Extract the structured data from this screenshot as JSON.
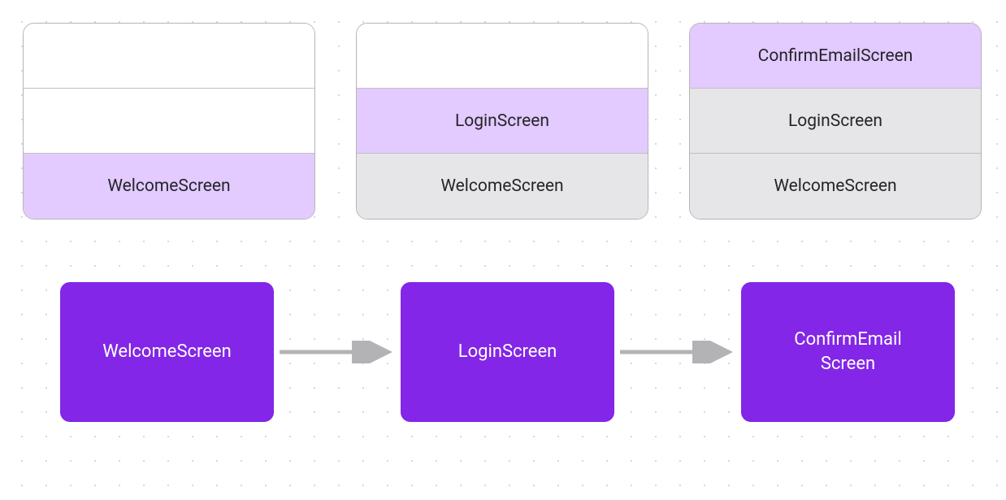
{
  "colors": {
    "accent_purple": "#8326e7",
    "lilac_highlight": "#e3caff",
    "grey_inactive": "#e6e6e8",
    "arrow": "#b3b3b6",
    "text_dark": "#25252b",
    "text_light": "#ffffff"
  },
  "stacks": [
    {
      "cells": [
        {
          "label": "",
          "style": "white"
        },
        {
          "label": "",
          "style": "white"
        },
        {
          "label": "WelcomeScreen",
          "style": "lilac"
        }
      ]
    },
    {
      "cells": [
        {
          "label": "",
          "style": "white"
        },
        {
          "label": "LoginScreen",
          "style": "lilac"
        },
        {
          "label": "WelcomeScreen",
          "style": "grey"
        }
      ]
    },
    {
      "cells": [
        {
          "label": "ConfirmEmailScreen",
          "style": "lilac"
        },
        {
          "label": "LoginScreen",
          "style": "grey"
        },
        {
          "label": "WelcomeScreen",
          "style": "grey"
        }
      ]
    }
  ],
  "flow": {
    "nodes": [
      {
        "label": "WelcomeScreen"
      },
      {
        "label": "LoginScreen"
      },
      {
        "label": "ConfirmEmail\nScreen"
      }
    ]
  }
}
